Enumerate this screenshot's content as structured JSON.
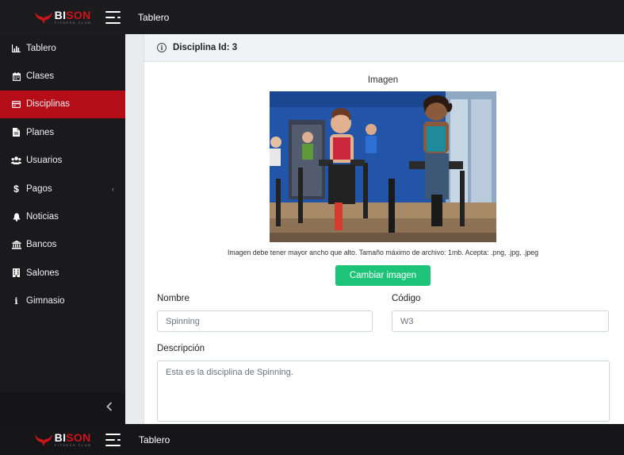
{
  "brand": {
    "name_part1": "BI",
    "name_part2": "SON",
    "tagline": "FITNESS CLUB",
    "accent": "#d0121b"
  },
  "header": {
    "title": "Tablero",
    "menu_icon": "hamburger-icon"
  },
  "sidebar": {
    "active_color": "#b50d18",
    "items": [
      {
        "label": "Tablero",
        "icon": "bar-chart-icon"
      },
      {
        "label": "Clases",
        "icon": "calendar-icon"
      },
      {
        "label": "Disciplinas",
        "icon": "card-icon"
      },
      {
        "label": "Planes",
        "icon": "document-icon"
      },
      {
        "label": "Usuarios",
        "icon": "users-icon"
      },
      {
        "label": "Pagos",
        "icon": "dollar-icon"
      },
      {
        "label": "Noticias",
        "icon": "bell-icon"
      },
      {
        "label": "Bancos",
        "icon": "bank-icon"
      },
      {
        "label": "Salones",
        "icon": "building-icon"
      },
      {
        "label": "Gimnasio",
        "icon": "info-icon"
      }
    ],
    "collapse_icon": "chevron-left-icon"
  },
  "card": {
    "title": "Disciplina Id: 3",
    "image_label": "Imagen",
    "image_help": "Imagen debe tener mayor ancho que alto. Tamaño máximo de archivo: 1mb. Acepta: .png, .jpg, .jpeg",
    "change_button": "Cambiar imagen",
    "button_color": "#1ec37a"
  },
  "form": {
    "nombre_label": "Nombre",
    "nombre_value": "Spinning",
    "codigo_label": "Código",
    "codigo_value": "W3",
    "descripcion_label": "Descripción",
    "descripcion_value": "Esta es la disciplina de Spinning."
  },
  "footer": {
    "title": "Tablero"
  }
}
